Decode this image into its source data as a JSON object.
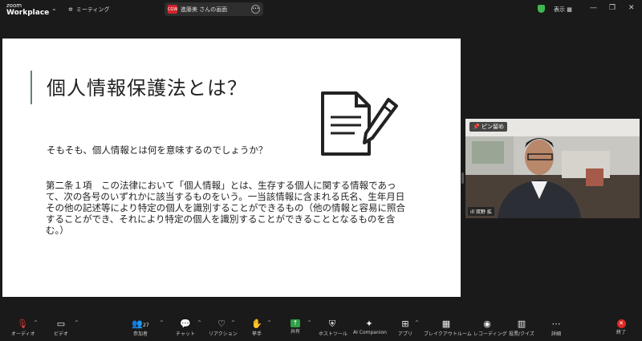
{
  "topbar": {
    "logo_line1": "zoom",
    "logo_line2": "Workplace",
    "meeting_label": "ミーティング",
    "share_badge": "CGW",
    "share_title": "進藤美 さんの画面",
    "view_label": "表示"
  },
  "slide": {
    "title": "個人情報保護法とは？",
    "question": "そもそも、個人情報とは何を意味するのでしょうか？",
    "article": "第二条１項　この法律において「個人情報」とは、生存する個人に関する情報であって、次の各号のいずれかに該当するものをいう。一当該情報に含まれる氏名、生年月日その他の記述等により特定の個人を識別することができるもの（他の情報と容易に照合することができ、それにより特定の個人を識別することができることとなるものを含む。）"
  },
  "video": {
    "pin_label": "ピン留め",
    "participant_name": "双野 拡"
  },
  "toolbar": {
    "audio": "オーディオ",
    "video": "ビデオ",
    "participants": "参加者",
    "participants_count": "27",
    "chat": "チャット",
    "reactions": "リアクション",
    "raise_hand": "挙手",
    "share": "共有",
    "host_tools": "ホストツール",
    "ai_companion": "AI Companion",
    "apps": "アプリ",
    "breakout": "ブレイクアウトルーム",
    "record": "レコーディング",
    "polls": "投票/クイズ",
    "more": "詳細",
    "end": "終了"
  }
}
